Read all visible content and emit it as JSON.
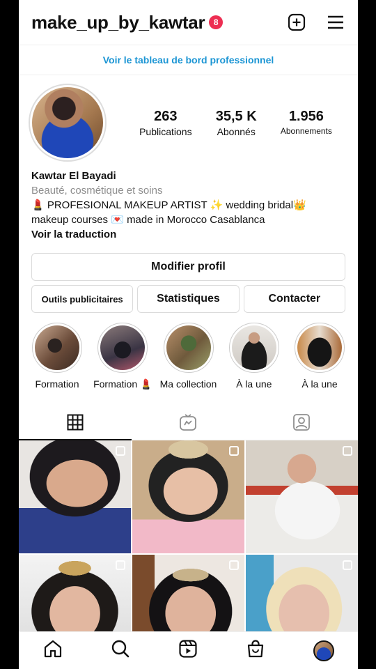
{
  "header": {
    "username": "make_up_by_kawtar",
    "notification_count": "8",
    "icons": [
      "plus-square-icon",
      "hamburger-menu-icon"
    ]
  },
  "pro_dashboard_link": "Voir le tableau de bord professionnel",
  "profile": {
    "stats": [
      {
        "value": "263",
        "label": "Publications"
      },
      {
        "value": "35,5 K",
        "label": "Abonnés"
      },
      {
        "value": "1.956",
        "label": "Abonnements"
      }
    ],
    "name": "Kawtar El Bayadi",
    "category": "Beauté, cosmétique et soins",
    "bio_line1": "💄 PROFESIONAL MAKEUP ARTIST ✨ wedding bridal👑",
    "bio_line2": "makeup courses 💌 made in Morocco Casablanca",
    "see_translation": "Voir la traduction"
  },
  "buttons": {
    "edit_profile": "Modifier profil",
    "ad_tools": "Outils publicitaires",
    "insights": "Statistiques",
    "contact": "Contacter"
  },
  "highlights": [
    {
      "label": "Formation"
    },
    {
      "label": "Formation 💄"
    },
    {
      "label": "Ma collection"
    },
    {
      "label": "À la une"
    },
    {
      "label": "À la une"
    }
  ],
  "tabs": [
    "grid-icon",
    "igtv-icon",
    "tagged-icon"
  ],
  "bottom_nav": [
    "home-icon",
    "search-icon",
    "reels-icon",
    "shop-icon",
    "profile-avatar"
  ],
  "colors": {
    "link_blue": "#1b95d4",
    "badge_red": "#ed2e52",
    "border": "#dbdbdb"
  }
}
